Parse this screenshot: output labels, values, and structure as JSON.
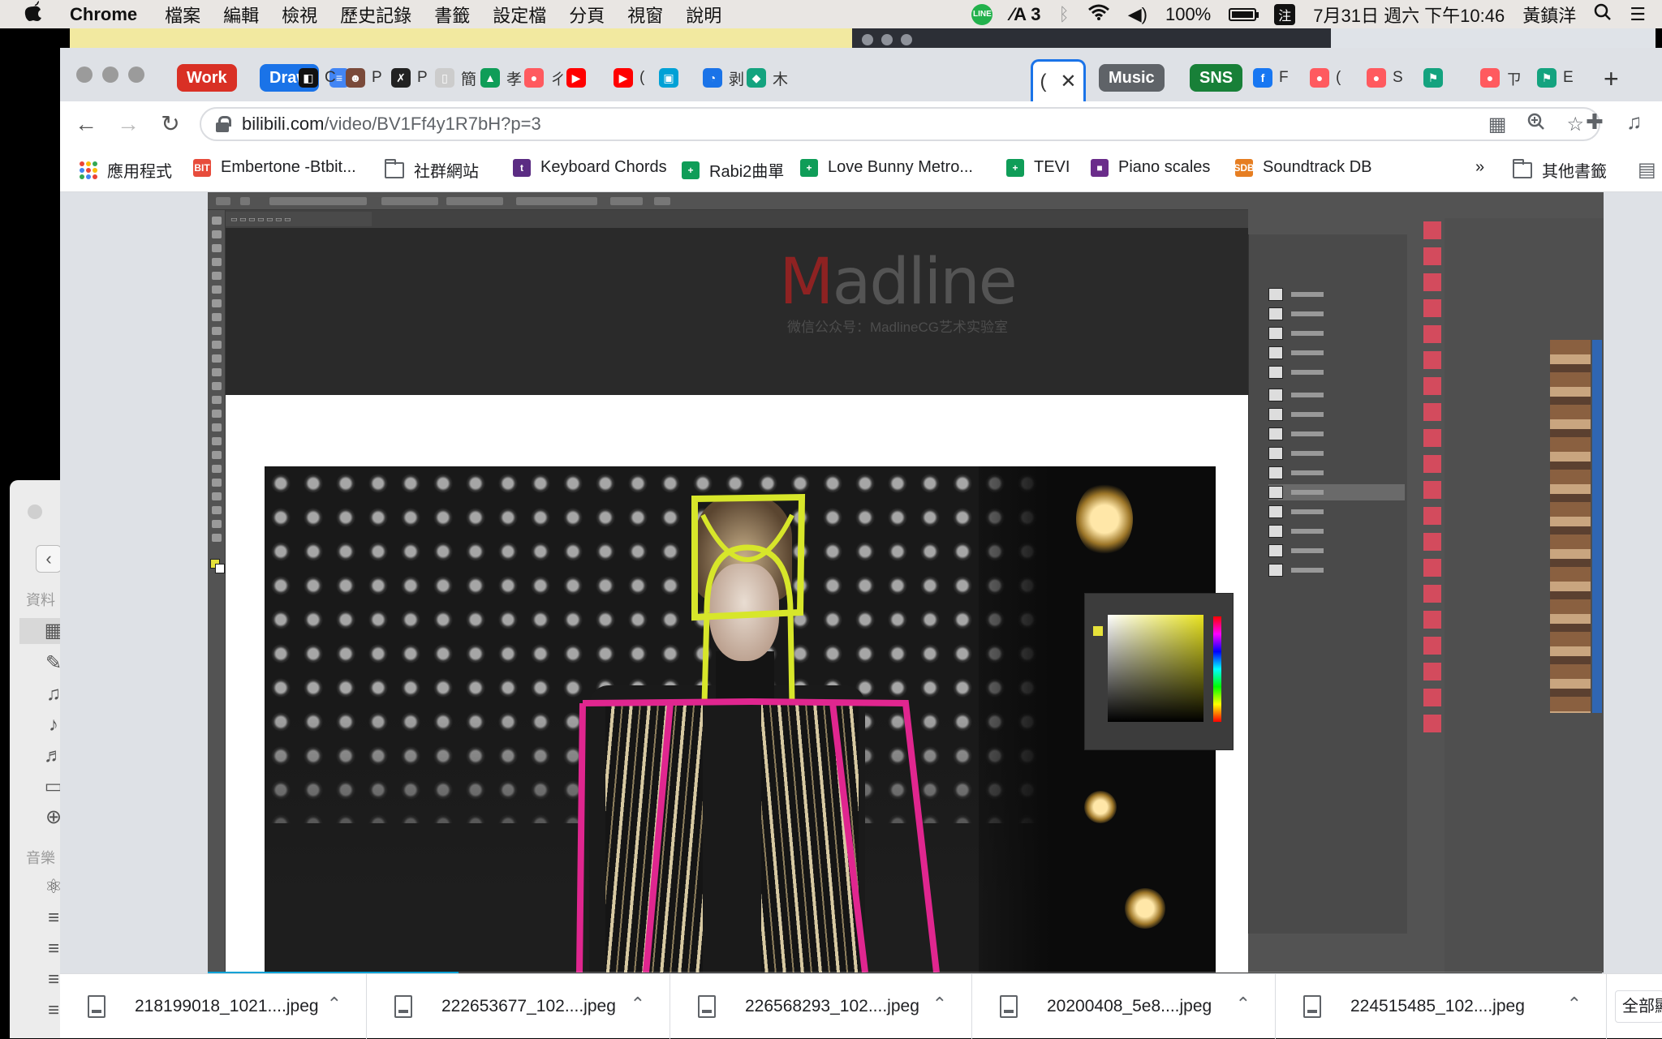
{
  "menubar": {
    "app_name": "Chrome",
    "menus": [
      "檔案",
      "編輯",
      "檢視",
      "歷史記錄",
      "書籤",
      "設定檔",
      "分頁",
      "視窗",
      "說明"
    ],
    "line_badge": "LINE",
    "adobe_count": "3",
    "battery": "100%",
    "battery_level": 1.0,
    "ime_label": "注",
    "datetime": "7月31日 週六 下午10:46",
    "user": "黃鎮洋"
  },
  "tabs": {
    "groups": [
      {
        "label": "Work",
        "color": "#d93025"
      },
      {
        "label": "Draw",
        "color": "#1a73e8"
      },
      {
        "label": "Music",
        "color": "#5f6368"
      },
      {
        "label": "SNS",
        "color": "#188038"
      }
    ],
    "mini_tabs": [
      {
        "letter": "C",
        "fav_color": "#111111",
        "fav_glyph": "◧"
      },
      {
        "letter": "P",
        "fav_color": "#7a4a3a",
        "fav_glyph": "☻"
      },
      {
        "letter": "P",
        "fav_color": "#222222",
        "fav_glyph": "✗"
      },
      {
        "letter": "簡",
        "fav_color": "#cccccc",
        "fav_glyph": "▯"
      },
      {
        "letter": "孝",
        "fav_color": "#0f9d58",
        "fav_glyph": "▲"
      },
      {
        "letter": "ㄔ",
        "fav_color": "#ff5a5f",
        "fav_glyph": "●"
      },
      {
        "letter": "",
        "fav_color": "#ff0000",
        "fav_glyph": "▶"
      },
      {
        "letter": "(",
        "fav_color": "#ff0000",
        "fav_glyph": "▶"
      },
      {
        "letter": "",
        "fav_color": "#00a1d6",
        "fav_glyph": "▣"
      },
      {
        "letter": "剥",
        "fav_color": "#1a73e8",
        "fav_glyph": "◔"
      },
      {
        "letter": "木",
        "fav_color": "#14a37f",
        "fav_glyph": "◆"
      }
    ],
    "active_tab_letter": "(",
    "sns_tabs": [
      {
        "letter": "F",
        "fav_color": "#1877f2",
        "fav_glyph": "f"
      },
      {
        "letter": "(",
        "fav_color": "#ff5a5f",
        "fav_glyph": "●"
      },
      {
        "letter": "S",
        "fav_color": "#ff5a5f",
        "fav_glyph": "●"
      },
      {
        "letter": "",
        "fav_color": "#14a37f",
        "fav_glyph": "⚑"
      },
      {
        "letter": "ㄗ",
        "fav_color": "#ff5a5f",
        "fav_glyph": "●"
      },
      {
        "letter": "E",
        "fav_color": "#14a37f",
        "fav_glyph": "⚑"
      }
    ]
  },
  "address": {
    "host": "bilibili.com",
    "path": "/video/BV1Ff4y1R7bH?p=3"
  },
  "bookmarks": {
    "items": [
      {
        "label": "應用程式",
        "kind": "apps"
      },
      {
        "label": "Embertone -Btbit...",
        "kind": "fav",
        "fav_color": "#e74c3c",
        "fav_text": "BIT"
      },
      {
        "label": "社群網站",
        "kind": "folder"
      },
      {
        "label": "Keyboard Chords",
        "kind": "fav",
        "fav_color": "#5b2c83",
        "fav_text": "t"
      },
      {
        "label": "Rabi2曲單",
        "kind": "fav",
        "fav_color": "#0f9d58",
        "fav_text": "+"
      },
      {
        "label": "Love Bunny Metro...",
        "kind": "fav",
        "fav_color": "#0f9d58",
        "fav_text": "+"
      },
      {
        "label": "TEVI",
        "kind": "fav",
        "fav_color": "#0f9d58",
        "fav_text": "+"
      },
      {
        "label": "Piano scales",
        "kind": "fav",
        "fav_color": "#6a2c8a",
        "fav_text": "■"
      },
      {
        "label": "Soundtrack DB",
        "kind": "fav",
        "fav_color": "#e67e22",
        "fav_text": "SDB"
      }
    ],
    "overflow": "»",
    "other": "其他書籤"
  },
  "video": {
    "watermark_title": "Madline",
    "watermark_sub": "微信公众号：MadlineCG艺术实验室",
    "progress": 0.18
  },
  "side_app": {
    "section_1": "資料",
    "section_2": "音樂"
  },
  "downloads": {
    "items": [
      "218199018_1021....jpeg",
      "222653677_102....jpeg",
      "226568293_102....jpeg",
      "20200408_5e8....jpeg",
      "224515485_102....jpeg"
    ],
    "show_all": "全部顯示"
  },
  "icons": {
    "apple": "apple-icon",
    "wifi": "wifi-icon",
    "volume": "volume-icon",
    "search": "search-icon",
    "control_center": "control-center-icon",
    "bluetooth": "bluetooth-icon"
  }
}
